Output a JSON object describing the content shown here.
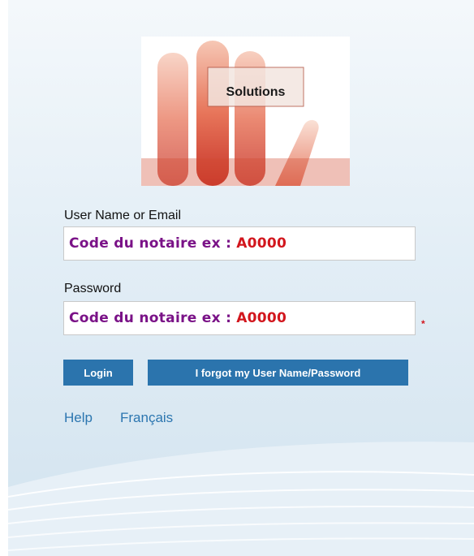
{
  "logo": {
    "text": "Solutions",
    "description_icon": "hand-image"
  },
  "login_form": {
    "username_label": "User Name or Email",
    "username_placeholder_main": "Code du notaire ex :",
    "username_placeholder_accent": "A0000",
    "password_label": "Password",
    "password_placeholder_main": "Code du notaire ex :",
    "password_placeholder_accent": "A0000",
    "required_marker": "*",
    "login_button": "Login",
    "forgot_button": "I forgot my User Name/Password"
  },
  "links": {
    "help": "Help",
    "language": "Français"
  },
  "colors": {
    "button": "#2b74ad",
    "link": "#2c76b0",
    "placeholder_main": "#7a1287",
    "placeholder_accent": "#d2161d"
  }
}
